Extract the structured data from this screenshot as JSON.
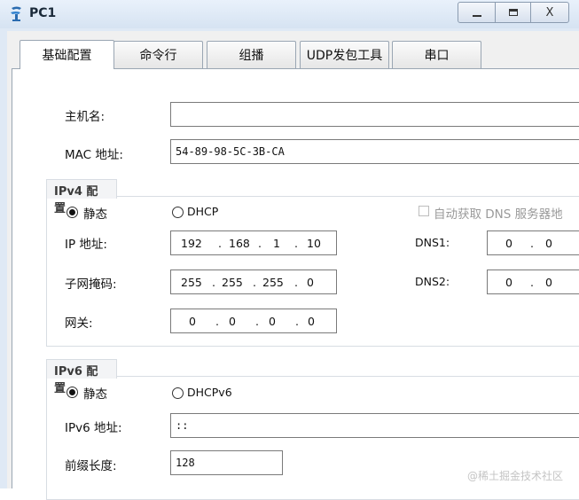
{
  "window": {
    "title": "PC1",
    "close_label": "X"
  },
  "tabs": [
    {
      "label": "基础配置",
      "active": true
    },
    {
      "label": "命令行",
      "active": false
    },
    {
      "label": "组播",
      "active": false
    },
    {
      "label": "UDP发包工具",
      "active": false
    },
    {
      "label": "串口",
      "active": false
    }
  ],
  "basic": {
    "hostname_label": "主机名:",
    "hostname_value": "",
    "mac_label": "MAC 地址:",
    "mac_value": "54-89-98-5C-3B-CA"
  },
  "ipv4": {
    "group_title": "IPv4 配置",
    "static_label": "静态",
    "dhcp_label": "DHCP",
    "mode_selected": "静态",
    "auto_dns_label": "自动获取 DNS 服务器地",
    "auto_dns_checked": false,
    "ip_label": "IP 地址:",
    "ip": [
      "192",
      "168",
      "1",
      "10"
    ],
    "mask_label": "子网掩码:",
    "mask": [
      "255",
      "255",
      "255",
      "0"
    ],
    "gateway_label": "网关:",
    "gateway": [
      "0",
      "0",
      "0",
      "0"
    ],
    "dns1_label": "DNS1:",
    "dns1": [
      "0",
      "0"
    ],
    "dns2_label": "DNS2:",
    "dns2": [
      "0",
      "0"
    ],
    "dot": "."
  },
  "ipv6": {
    "group_title": "IPv6 配置",
    "static_label": "静态",
    "dhcp_label": "DHCPv6",
    "mode_selected": "静态",
    "ip_label": "IPv6 地址:",
    "ip_value": "::",
    "prefix_label": "前缀长度:",
    "prefix_value": "128"
  },
  "watermark": "@稀土掘金技术社区",
  "colors": {
    "titlebar": "#dfe9f5",
    "client": "#f0f0f0",
    "panel": "#ffffff",
    "border": "#7a7a7a"
  }
}
